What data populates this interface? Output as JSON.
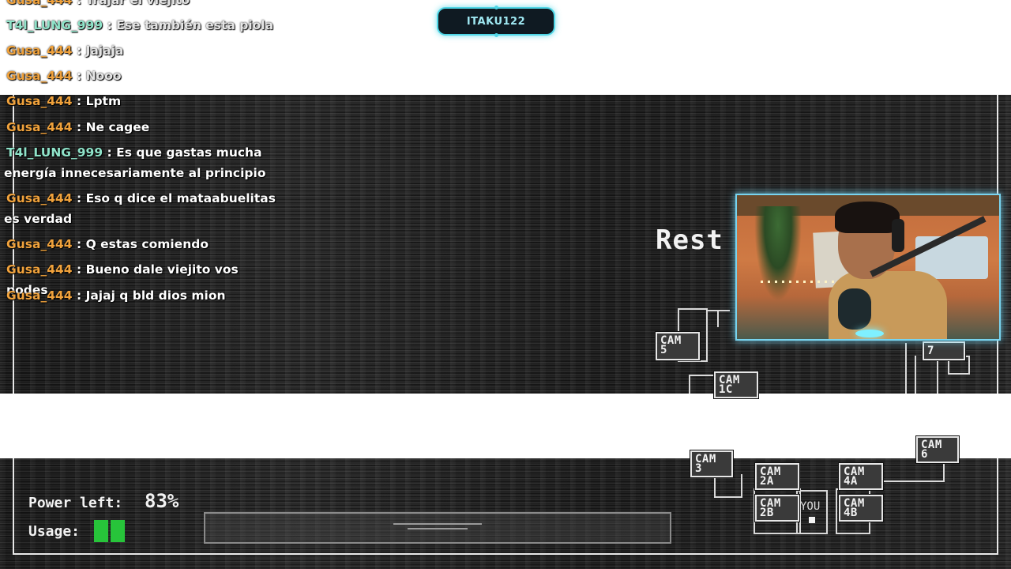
{
  "stream": {
    "streamer_name": "ITAKU122"
  },
  "chat": {
    "messages": [
      {
        "user": "Gusa_444",
        "text": "Trajar el viejito"
      },
      {
        "user": "T4l_LUNG_999",
        "text": "Ese también esta piola"
      },
      {
        "user": "Gusa_444",
        "text": "Jajaja"
      },
      {
        "user": "Gusa_444",
        "text": "Nooo"
      },
      {
        "user": "Gusa_444",
        "text": "Lptm"
      },
      {
        "user": "Gusa_444",
        "text": "Ne cagee"
      },
      {
        "user": "T4l_LUNG_999",
        "text": "Es que gastas mucha energía innecesariamente al principio"
      },
      {
        "user": "Gusa_444",
        "text": "Eso q dice el mataabuelitas es verdad"
      },
      {
        "user": "Gusa_444",
        "text": "Q estas comiendo"
      },
      {
        "user": "Gusa_444",
        "text": "Bueno dale viejito vos podes"
      },
      {
        "user": "Gusa_444",
        "text": "Jajaj q bld dios mion"
      }
    ],
    "separator": ":"
  },
  "game": {
    "restart_text": "Rest",
    "power_label": "Power left:",
    "power_value": "83%",
    "usage_label": "Usage:",
    "usage_level": 2,
    "you_label": "YOU",
    "cameras": {
      "cam5": "CAM\n5",
      "cam1c": "CAM\n1C",
      "cam7": "7",
      "cam3": "CAM\n3",
      "cam2a": "CAM\n2A",
      "cam2b": "CAM\n2B",
      "cam4a": "CAM\n4A",
      "cam4b": "CAM\n4B",
      "cam6": "CAM\n6"
    }
  },
  "colors": {
    "badge_accent": "#4fd6e6",
    "username_orange": "#f0a23c",
    "username_green": "#8fe3c9",
    "usage_green": "#27c43a",
    "webcam_border": "#78d4ef"
  }
}
